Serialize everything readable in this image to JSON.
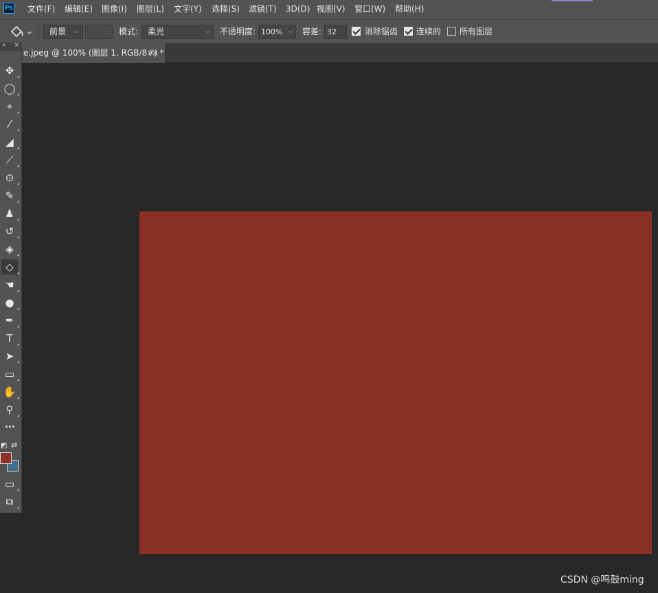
{
  "app": {
    "logo": "Ps"
  },
  "menu": [
    "文件(F)",
    "编辑(E)",
    "图像(I)",
    "图层(L)",
    "文字(Y)",
    "选择(S)",
    "滤镜(T)",
    "3D(D)",
    "视图(V)",
    "窗口(W)",
    "帮助(H)"
  ],
  "options": {
    "tool_icon": "paint-bucket-icon",
    "fill_source": "前景",
    "pattern_label": "",
    "mode_label": "模式:",
    "mode_value": "柔光",
    "opacity_label": "不透明度:",
    "opacity_value": "100%",
    "tolerance_label": "容差:",
    "tolerance_value": "32",
    "antialias_label": "消除锯齿",
    "antialias_checked": true,
    "contiguous_label": "连续的",
    "contiguous_checked": true,
    "all_layers_label": "所有图层",
    "all_layers_checked": false
  },
  "document_tab": {
    "title": "e.jpeg @ 100% (图层 1, RGB/8#) *",
    "close": "×"
  },
  "toolbox": {
    "tools": [
      {
        "name": "move-tool",
        "icon": "move-icon",
        "glyph": "✥"
      },
      {
        "name": "elliptical-marquee-tool",
        "icon": "ellipse-marquee-icon",
        "glyph": "◯"
      },
      {
        "name": "polygonal-lasso-tool",
        "icon": "lasso-icon",
        "glyph": "⌖"
      },
      {
        "name": "magic-wand-tool",
        "icon": "magic-wand-icon",
        "glyph": "⁄"
      },
      {
        "name": "crop-tool",
        "icon": "slice-icon",
        "glyph": "◢"
      },
      {
        "name": "eyedropper-tool",
        "icon": "eyedropper-icon",
        "glyph": "⟋"
      },
      {
        "name": "spot-healing-tool",
        "icon": "healing-icon",
        "glyph": "⊙"
      },
      {
        "name": "brush-tool",
        "icon": "brush-icon",
        "glyph": "✎"
      },
      {
        "name": "clone-stamp-tool",
        "icon": "stamp-icon",
        "glyph": "♟"
      },
      {
        "name": "history-brush-tool",
        "icon": "history-brush-icon",
        "glyph": "↺"
      },
      {
        "name": "eraser-tool",
        "icon": "eraser-icon",
        "glyph": "◈"
      },
      {
        "name": "paint-bucket-tool",
        "icon": "paint-bucket-icon",
        "glyph": "◇"
      },
      {
        "name": "smudge-tool",
        "icon": "smudge-icon",
        "glyph": "☚"
      },
      {
        "name": "dodge-tool",
        "icon": "dodge-icon",
        "glyph": "●"
      },
      {
        "name": "pen-tool",
        "icon": "pen-icon",
        "glyph": "✒"
      },
      {
        "name": "type-tool",
        "icon": "type-icon",
        "glyph": "T"
      },
      {
        "name": "path-selection-tool",
        "icon": "path-select-icon",
        "glyph": "➤"
      },
      {
        "name": "rectangle-tool",
        "icon": "rectangle-icon",
        "glyph": "▭"
      },
      {
        "name": "hand-tool",
        "icon": "hand-icon",
        "glyph": "✋"
      },
      {
        "name": "zoom-tool",
        "icon": "zoom-icon",
        "glyph": "⚲"
      },
      {
        "name": "more-tools",
        "icon": "ellipsis-icon",
        "glyph": "•••"
      }
    ],
    "active_tool": "paint-bucket-tool",
    "foreground_color": "#8b3024",
    "background_color": "#416e8d"
  },
  "canvas": {
    "fill_color": "#8b3024",
    "background": "#282828"
  },
  "watermark": "CSDN @鸣鼓ming"
}
